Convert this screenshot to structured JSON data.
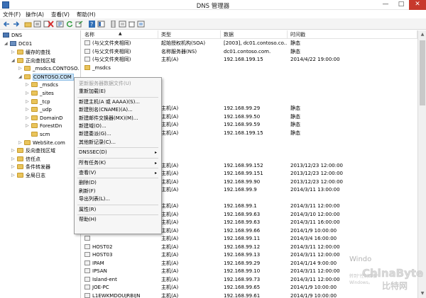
{
  "window": {
    "title": "DNS 管理器",
    "minimize": "—",
    "maximize": "□",
    "close": "✕"
  },
  "menu": [
    "文件(F)",
    "操作(A)",
    "查看(V)",
    "帮助(H)"
  ],
  "toolbar_icons": [
    "back-icon",
    "forward-icon",
    "folder-icon",
    "list-icon",
    "doc-icon",
    "delete-icon",
    "properties-icon",
    "refresh-icon",
    "export-icon",
    "help-icon",
    "view-icon",
    "server-icon",
    "record-icon",
    "trash-icon",
    "settings-icon"
  ],
  "tree": {
    "root": "DNS",
    "server": "DC01",
    "items": [
      {
        "label": "缓存的查找",
        "level": 2,
        "exp": "▷"
      },
      {
        "label": "正向查找区域",
        "level": 2,
        "exp": "◢"
      },
      {
        "label": "_msdcs.CONTOSO.",
        "level": 3,
        "exp": "▷"
      },
      {
        "label": "CONTOSO.COM",
        "level": 3,
        "exp": "◢",
        "selected": true
      },
      {
        "label": "_msdcs",
        "level": 4,
        "exp": "▷"
      },
      {
        "label": "_sites",
        "level": 4,
        "exp": "▷"
      },
      {
        "label": "_tcp",
        "level": 4,
        "exp": "▷"
      },
      {
        "label": "_udp",
        "level": 4,
        "exp": "▷"
      },
      {
        "label": "DomainD",
        "level": 4,
        "exp": "▷"
      },
      {
        "label": "ForestDn",
        "level": 4,
        "exp": "▷"
      },
      {
        "label": "scm",
        "level": 4,
        "exp": ""
      },
      {
        "label": "WebSite.com",
        "level": 3,
        "exp": "▷"
      },
      {
        "label": "反向查找区域",
        "level": 2,
        "exp": "▷"
      },
      {
        "label": "信任点",
        "level": 2,
        "exp": "▷"
      },
      {
        "label": "条件转发器",
        "level": 2,
        "exp": "▷"
      },
      {
        "label": "全局日志",
        "level": 2,
        "exp": "▷"
      }
    ]
  },
  "columns": [
    "名称",
    "类型",
    "数据",
    "时间戳"
  ],
  "rows": [
    {
      "name": "(与父文件夹相同)",
      "type": "起始授权机构(SOA)",
      "data": "[2003], dc01.contoso.co...",
      "ts": "静态"
    },
    {
      "name": "(与父文件夹相同)",
      "type": "名称服务器(NS)",
      "data": "dc01.contoso.com.",
      "ts": "静态"
    },
    {
      "name": "(与父文件夹相同)",
      "type": "主机(A)",
      "data": "192.168.199.15",
      "ts": "2014/4/22 19:00:00"
    },
    {
      "name": "_msdcs",
      "type": "",
      "data": "",
      "ts": "",
      "folder": true
    },
    {
      "name": "",
      "type": "",
      "data": "",
      "ts": ""
    },
    {
      "name": "",
      "type": "",
      "data": "",
      "ts": ""
    },
    {
      "name": "",
      "type": "",
      "data": "",
      "ts": ""
    },
    {
      "name": "",
      "type": "",
      "data": "",
      "ts": ""
    },
    {
      "name": "",
      "type": "主机(A)",
      "data": "192.168.99.29",
      "ts": "静态"
    },
    {
      "name": "",
      "type": "主机(A)",
      "data": "192.168.99.50",
      "ts": "静态"
    },
    {
      "name": "",
      "type": "主机(A)",
      "data": "192.168.99.59",
      "ts": "静态"
    },
    {
      "name": "",
      "type": "主机(A)",
      "data": "192.168.199.15",
      "ts": "静态"
    },
    {
      "name": "",
      "type": "",
      "data": "",
      "ts": ""
    },
    {
      "name": "",
      "type": "",
      "data": "",
      "ts": ""
    },
    {
      "name": "",
      "type": "",
      "data": "",
      "ts": ""
    },
    {
      "name": "",
      "type": "主机(A)",
      "data": "192.168.99.152",
      "ts": "2013/12/23 12:00:00"
    },
    {
      "name": "",
      "type": "主机(A)",
      "data": "192.168.99.151",
      "ts": "2013/12/23 12:00:00"
    },
    {
      "name": "",
      "type": "主机(A)",
      "data": "192.168.99.90",
      "ts": "2013/12/23 12:00:00"
    },
    {
      "name": "",
      "type": "主机(A)",
      "data": "192.168.99.9",
      "ts": "2014/3/11 13:00:00"
    },
    {
      "name": "",
      "type": "",
      "data": "",
      "ts": ""
    },
    {
      "name": "",
      "type": "主机(A)",
      "data": "192.168.99.1",
      "ts": "2014/3/11 12:00:00"
    },
    {
      "name": "",
      "type": "主机(A)",
      "data": "192.168.99.63",
      "ts": "2014/3/10 12:00:00"
    },
    {
      "name": "",
      "type": "主机(A)",
      "data": "192.168.99.63",
      "ts": "2014/3/11 16:00:00"
    },
    {
      "name": "",
      "type": "主机(A)",
      "data": "192.168.99.66",
      "ts": "2014/1/9 10:00:00"
    },
    {
      "name": "",
      "type": "主机(A)",
      "data": "192.168.99.11",
      "ts": "2014/3/4 16:00:00"
    },
    {
      "name": "HOST02",
      "type": "主机(A)",
      "data": "192.168.99.12",
      "ts": "2014/3/11 12:00:00"
    },
    {
      "name": "HOST03",
      "type": "主机(A)",
      "data": "192.168.99.13",
      "ts": "2014/3/11 12:00:00"
    },
    {
      "name": "IPAM",
      "type": "主机(A)",
      "data": "192.168.99.29",
      "ts": "2014/1/14 9:00:00"
    },
    {
      "name": "IPSAN",
      "type": "主机(A)",
      "data": "192.168.99.10",
      "ts": "2014/3/11 12:00:00"
    },
    {
      "name": "Island-ent",
      "type": "主机(A)",
      "data": "192.168.99.73",
      "ts": "2014/3/11 12:00:00"
    },
    {
      "name": "JOE-PC",
      "type": "主机(A)",
      "data": "192.168.99.65",
      "ts": "2014/1/9 10:00:00"
    },
    {
      "name": "L1EWKMDOUJRBIJN",
      "type": "主机(A)",
      "data": "192.168.99.61",
      "ts": "2014/1/9 10:00:00"
    }
  ],
  "context_menu": [
    {
      "label": "更新服务器数据文件(U)",
      "disabled": true
    },
    {
      "label": "重新加载(E)"
    },
    {
      "sep": true
    },
    {
      "label": "新建主机(A 或 AAAA)(S)..."
    },
    {
      "label": "新建别名(CNAME)(A)..."
    },
    {
      "label": "新建邮件交换器(MX)(M)..."
    },
    {
      "label": "新建域(O)..."
    },
    {
      "label": "新建委派(G)..."
    },
    {
      "label": "其他新记录(C)..."
    },
    {
      "sep": true
    },
    {
      "label": "DNSSEC(D)",
      "submenu": true
    },
    {
      "sep": true
    },
    {
      "label": "所有任务(K)",
      "submenu": true
    },
    {
      "sep": true
    },
    {
      "label": "查看(V)",
      "submenu": true
    },
    {
      "sep": true
    },
    {
      "label": "删除(D)"
    },
    {
      "label": "刷新(F)"
    },
    {
      "label": "导出列表(L)..."
    },
    {
      "sep": true
    },
    {
      "label": "属性(R)"
    },
    {
      "sep": true
    },
    {
      "label": "帮助(H)"
    }
  ],
  "watermark": {
    "line1": "Windo",
    "brand": "ChinaByte",
    "brand_cn": "比特网",
    "sub": "转到\"控制面板\"",
    "sub2": "Windows。"
  },
  "colors": {
    "close_button": "#c7392c",
    "selection": "#cce4f7",
    "folder": "#e9c45c"
  }
}
